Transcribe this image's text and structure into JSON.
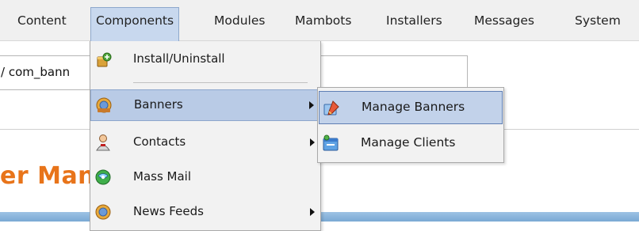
{
  "menubar": {
    "items": [
      {
        "label": "Content",
        "active": false
      },
      {
        "label": "Components",
        "active": true
      },
      {
        "label": "Modules",
        "active": false
      },
      {
        "label": "Mambots",
        "active": false
      },
      {
        "label": "Installers",
        "active": false
      },
      {
        "label": "Messages",
        "active": false
      },
      {
        "label": "System",
        "active": false
      }
    ]
  },
  "page": {
    "path_text": "/ com_bann",
    "heading": "er Man"
  },
  "dropdown": {
    "items": [
      {
        "label": "Install/Uninstall",
        "icon": "install-package-icon",
        "has_submenu": false
      },
      {
        "label": "Banners",
        "icon": "banners-icon",
        "has_submenu": true
      },
      {
        "label": "Contacts",
        "icon": "contacts-icon",
        "has_submenu": true
      },
      {
        "label": "Mass Mail",
        "icon": "mass-mail-icon",
        "has_submenu": false
      },
      {
        "label": "News Feeds",
        "icon": "news-feeds-icon",
        "has_submenu": true
      }
    ]
  },
  "submenu": {
    "items": [
      {
        "label": "Manage Banners",
        "icon": "manage-banners-icon"
      },
      {
        "label": "Manage Clients",
        "icon": "manage-clients-icon"
      }
    ]
  },
  "colors": {
    "accent_orange": "#e8741a",
    "menu_highlight": "#b9cbe6",
    "submenu_highlight_border": "#5f7fb4"
  }
}
